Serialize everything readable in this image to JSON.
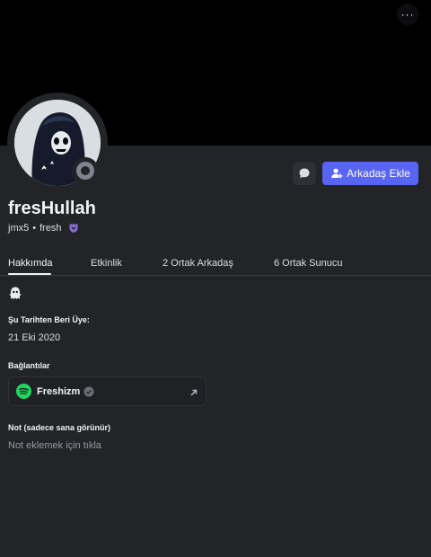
{
  "profile": {
    "display_name": "fresHullah",
    "username": "jmx5",
    "separator": "•",
    "pronoun_tag": "fresh"
  },
  "actions": {
    "add_friend_label": "Arkadaş Ekle",
    "more_label": "···"
  },
  "tabs": [
    {
      "label": "Hakkımda"
    },
    {
      "label": "Etkinlik"
    },
    {
      "label": "2 Ortak Arkadaş"
    },
    {
      "label": "6 Ortak Sunucu"
    }
  ],
  "about": {
    "member_since_title": "Şu Tarihten Beri Üye:",
    "member_since_value": "21 Eki 2020",
    "connections_title": "Bağlantılar",
    "connection": {
      "service": "spotify",
      "name": "Freshizm"
    },
    "note_title": "Not (sadece sana görünür)",
    "note_placeholder": "Not eklemek için tıkla"
  },
  "colors": {
    "accent": "#5865f2",
    "spotify": "#1ed760",
    "status_offline": "#80848e",
    "badge": "#8b6fd1"
  },
  "icons": [
    "more-icon",
    "message-icon",
    "add-friend-icon",
    "guild-badge-icon",
    "ghost-icon",
    "spotify-icon",
    "verified-icon",
    "external-link-icon"
  ]
}
